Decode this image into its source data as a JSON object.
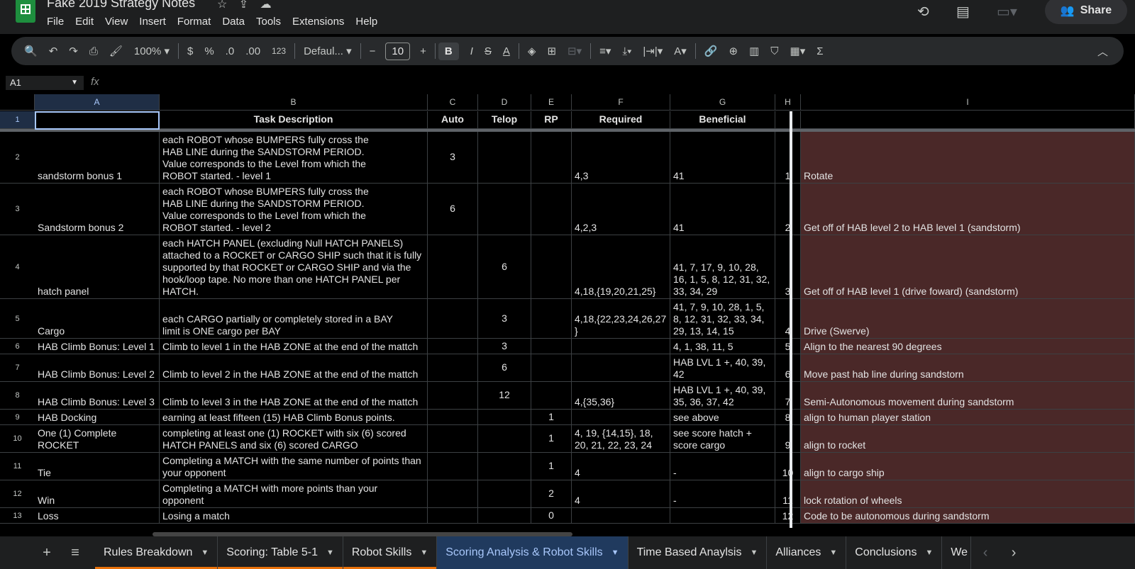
{
  "app": {
    "title": "Fake 2019 Strategy Notes",
    "share_label": "Share"
  },
  "menu": [
    "File",
    "Edit",
    "View",
    "Insert",
    "Format",
    "Data",
    "Tools",
    "Extensions",
    "Help"
  ],
  "toolbar": {
    "zoom": "100%",
    "currency": "$",
    "percent": "%",
    "dec_minus": ".0",
    "dec_plus": ".00",
    "number_format": "123",
    "font": "Defaul...",
    "font_size": "10",
    "bold": "B",
    "italic": "I",
    "text_color": "A",
    "sum": "Σ"
  },
  "formula_bar": {
    "cell_ref": "A1",
    "fx": "fx",
    "value": ""
  },
  "columns": [
    "A",
    "B",
    "C",
    "D",
    "E",
    "F",
    "G",
    "H",
    "I"
  ],
  "header_row": [
    "",
    "Task Description",
    "Auto",
    "Telop",
    "RP",
    "Required",
    "Beneficial",
    "",
    ""
  ],
  "rows": [
    {
      "num": "2",
      "a": "sandstorm bonus 1",
      "b": "each ROBOT whose BUMPERS fully cross the\nHAB LINE during the SANDSTORM PERIOD.\nValue corresponds to the Level from which the\nROBOT started. - level 1",
      "c": "3",
      "d": "",
      "e": "",
      "f": "4,3",
      "g": "41",
      "h": "1",
      "i": "Rotate"
    },
    {
      "num": "3",
      "a": "Sandstorm bonus 2",
      "b": "each ROBOT whose BUMPERS fully cross the\nHAB LINE during the SANDSTORM PERIOD.\nValue corresponds to the Level from which the\nROBOT started. - level 2",
      "c": "6",
      "d": "",
      "e": "",
      "f": "4,2,3",
      "g": "41",
      "h": "2",
      "i": "Get off of HAB level 2 to HAB level 1  (sandstorm)"
    },
    {
      "num": "4",
      "a": "hatch panel",
      "b": "each HATCH PANEL (excluding Null HATCH PANELS)\nattached to a ROCKET or CARGO SHIP such that it is fully\nsupported by that ROCKET or CARGO SHIP and via the\nhook/loop tape. No more than one HATCH PANEL per\nHATCH.",
      "c": "",
      "d": "6",
      "e": "",
      "f": "4,18,{19,20,21,25}",
      "g": "41, 7, 17, 9, 10, 28,\n16, 1, 5, 8, 12, 31, 32,\n33, 34, 29",
      "h": "3",
      "i": "Get off of HAB level 1 (drive foward) (sandstorm)"
    },
    {
      "num": "5",
      "a": "Cargo",
      "b": "each CARGO partially or completely stored in a BAY\nlimit is ONE cargo per BAY",
      "c": "",
      "d": "3",
      "e": "",
      "f": "4,18,{22,23,24,26,27\n}",
      "g": "41, 7, 9, 10, 28, 1, 5,\n8, 12, 31, 32, 33, 34,\n29, 13, 14, 15",
      "h": "4",
      "i": "Drive (Swerve)"
    },
    {
      "num": "6",
      "a": "HAB Climb Bonus: Level 1",
      "b": "Climb to level 1 in the HAB ZONE at the end of the mattch",
      "c": "",
      "d": "3",
      "e": "",
      "f": "",
      "g": "4, 1, 38, 11, 5",
      "h": "5",
      "i": "Align to the nearest 90 degrees"
    },
    {
      "num": "7",
      "a": "HAB Climb Bonus: Level 2",
      "b": "Climb to level 2 in the HAB ZONE at the end of the mattch",
      "c": "",
      "d": "6",
      "e": "",
      "f": "",
      "g": "HAB LVL 1 +, 40, 39,\n42",
      "h": "6",
      "i": "Move past hab line during sandstorn"
    },
    {
      "num": "8",
      "a": "HAB Climb Bonus: Level 3",
      "b": "Climb to level 3 in the HAB ZONE at the end of the mattch",
      "c": "",
      "d": "12",
      "e": "",
      "f": "4,{35,36}",
      "g": "HAB LVL 1 +, 40, 39,\n35, 36, 37, 42",
      "h": "7",
      "i": "Semi-Autonomous movement during sandstorm"
    },
    {
      "num": "9",
      "a": "HAB Docking",
      "b": "earning at least fifteen (15) HAB Climb Bonus points.",
      "c": "",
      "d": "",
      "e": "1",
      "f": "",
      "g": "see above",
      "h": "8",
      "i": "align to human player station"
    },
    {
      "num": "10",
      "a": "One (1) Complete\nROCKET",
      "b": "completing at least one (1) ROCKET with six (6) scored\nHATCH PANELS and six (6) scored CARGO",
      "c": "",
      "d": "",
      "e": "1",
      "f": "4, 19, {14,15}, 18,\n20, 21, 22, 23, 24",
      "g": "see score hatch +\nscore cargo",
      "h": "9",
      "i": "align to rocket"
    },
    {
      "num": "11",
      "a": "Tie",
      "b": "Completing a MATCH with the same number of points than\nyour opponent",
      "c": "",
      "d": "",
      "e": "1",
      "f": "4",
      "g": "-",
      "h": "10",
      "i": "align to cargo ship"
    },
    {
      "num": "12",
      "a": "Win",
      "b": "Completing a MATCH with more points than your\nopponent",
      "c": "",
      "d": "",
      "e": "2",
      "f": "4",
      "g": "-",
      "h": "11",
      "i": "lock rotation of wheels"
    },
    {
      "num": "13",
      "a": "Loss",
      "b": "Losing a match",
      "c": "",
      "d": "",
      "e": "0",
      "f": "",
      "g": "",
      "h": "12",
      "i": "Code to be autonomous during sandstorm"
    }
  ],
  "sheet_tabs": [
    "Rules Breakdown",
    "Scoring: Table 5-1",
    "Robot Skills",
    "Scoring Analysis & Robot Skills",
    "Time Based Anaylsis",
    "Alliances",
    "Conclusions",
    "We"
  ],
  "colors": {
    "accent": "#a8c7fa",
    "tab_underline": "#e8710a",
    "highlight_column": "#4a2828"
  }
}
